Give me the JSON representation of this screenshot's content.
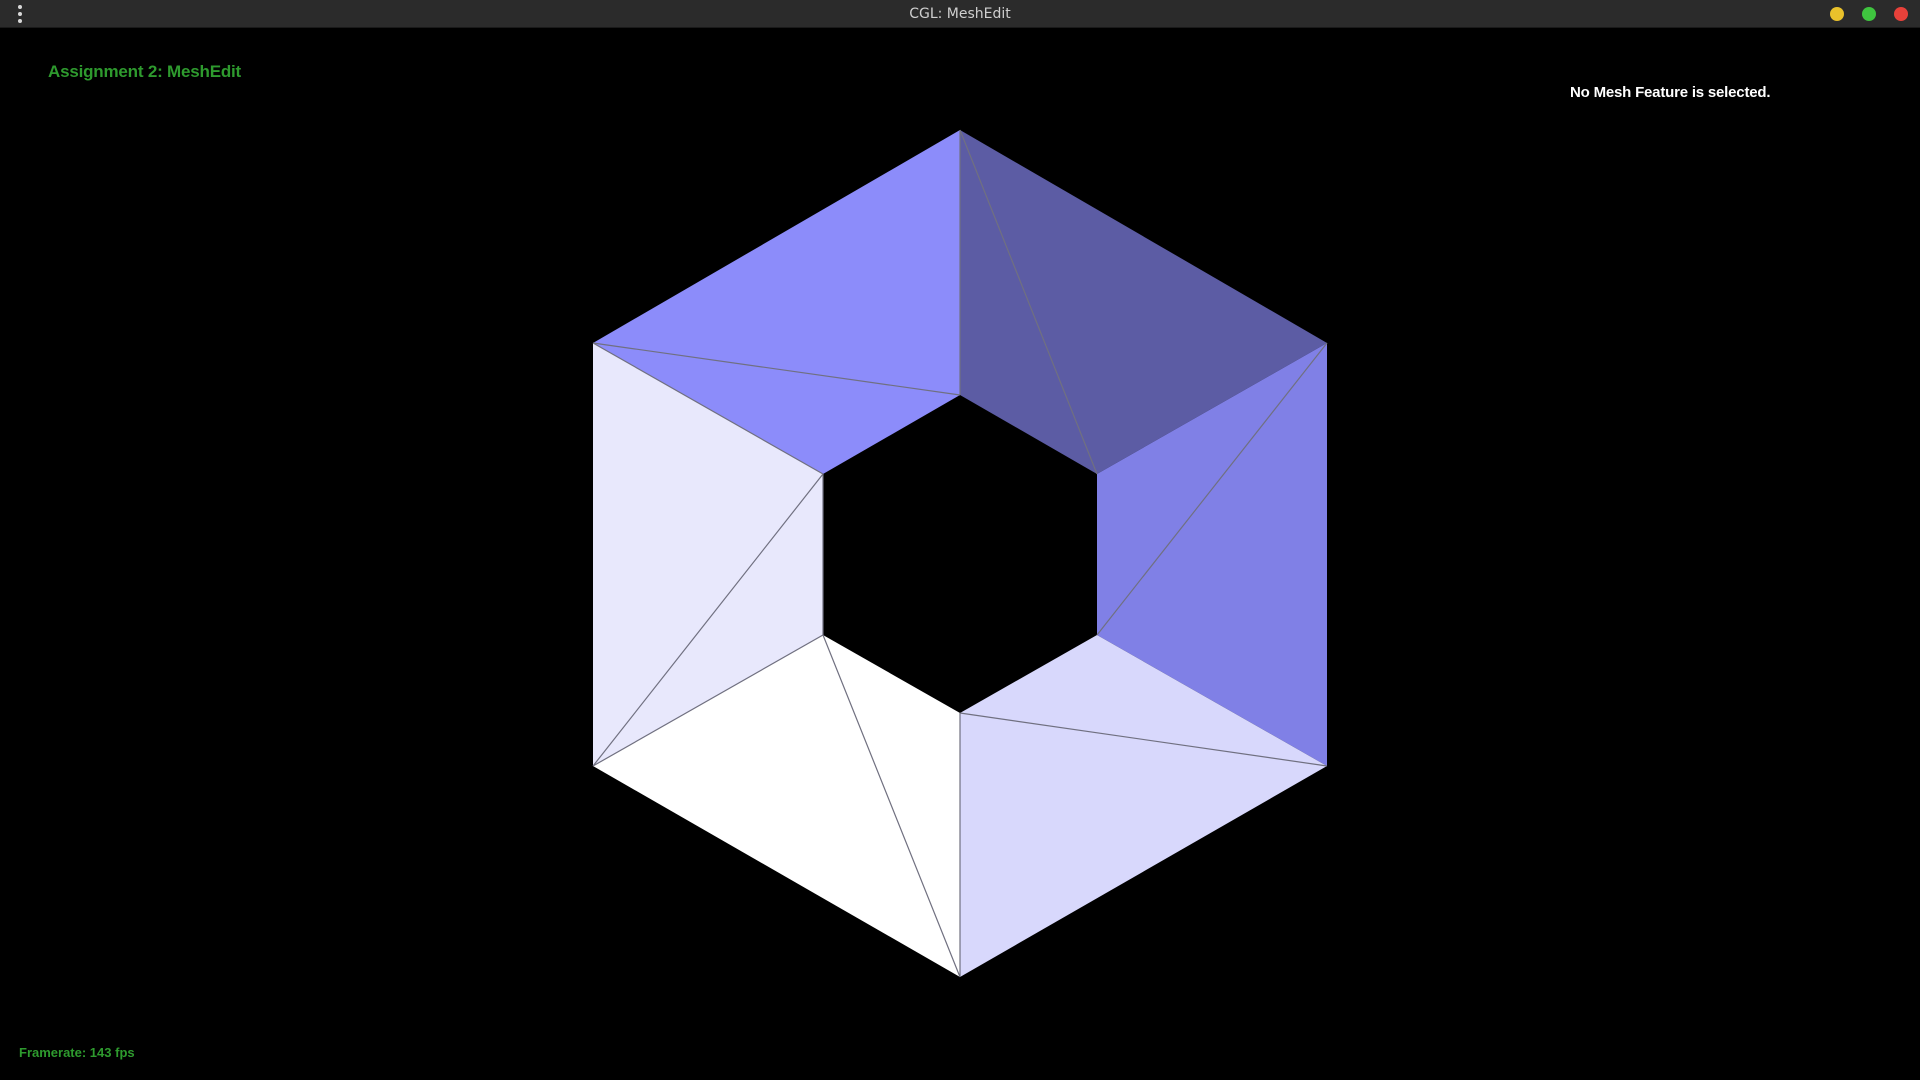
{
  "window": {
    "title": "CGL: MeshEdit",
    "menu_icon": "kebab-menu-icon",
    "controls": [
      {
        "name": "minimize-button",
        "color": "#e9c12b"
      },
      {
        "name": "maximize-button",
        "color": "#3fc43f"
      },
      {
        "name": "close-button",
        "color": "#e8413a"
      }
    ]
  },
  "hud": {
    "title": "Assignment 2: MeshEdit",
    "selection_status": "No Mesh Feature is selected.",
    "framerate": "Framerate: 143 fps",
    "text_color": "#2e9a2e"
  },
  "mesh": {
    "shape": "hexagonal ring of 12 triangles",
    "edge_color": "#707080",
    "face_colors": [
      "#8c8cfa",
      "#5c5ca4",
      "#8080e6",
      "#d8d8fc",
      "#ffffff",
      "#e8e8fc"
    ]
  }
}
